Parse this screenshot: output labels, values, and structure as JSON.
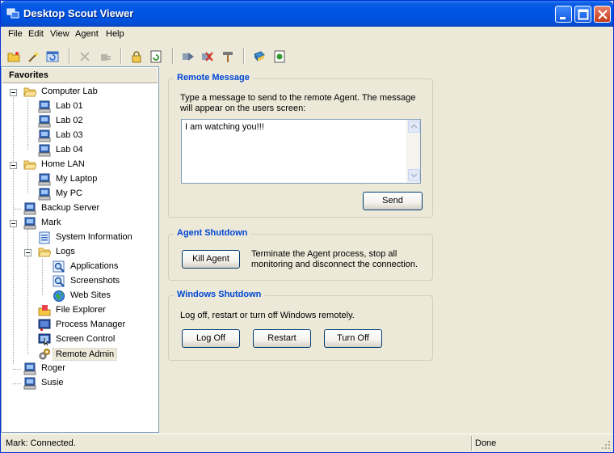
{
  "window": {
    "title": "Desktop Scout Viewer"
  },
  "menu": [
    "File",
    "Edit",
    "View",
    "Agent",
    "Help"
  ],
  "toolbar": {
    "icons": [
      "open-folder-icon",
      "wand-icon",
      "refresh-window-icon",
      "delete-icon",
      "plug-icon",
      "lock-icon",
      "sync-icon",
      "forward-icon",
      "cancel-icon",
      "tool-icon",
      "book-icon",
      "page-icon"
    ]
  },
  "tree": {
    "header": "Favorites",
    "items": [
      {
        "label": "Computer Lab"
      },
      {
        "label": "Lab 01"
      },
      {
        "label": "Lab 02"
      },
      {
        "label": "Lab 03"
      },
      {
        "label": "Lab 04"
      },
      {
        "label": "Home LAN"
      },
      {
        "label": "My Laptop"
      },
      {
        "label": "My PC"
      },
      {
        "label": "Backup Server"
      },
      {
        "label": "Mark"
      },
      {
        "label": "System Information"
      },
      {
        "label": "Logs"
      },
      {
        "label": "Applications"
      },
      {
        "label": "Screenshots"
      },
      {
        "label": "Web Sites"
      },
      {
        "label": "File Explorer"
      },
      {
        "label": "Process Manager"
      },
      {
        "label": "Screen Control"
      },
      {
        "label": "Remote Admin"
      },
      {
        "label": "Roger"
      },
      {
        "label": "Susie"
      }
    ]
  },
  "remote_message": {
    "title": "Remote Message",
    "description_line1": "Type a message to send to the remote Agent. The message",
    "description_line2": "will appear on the users screen:",
    "message": "I am watching you!!!",
    "send_label": "Send"
  },
  "agent_shutdown": {
    "title": "Agent Shutdown",
    "kill_label": "Kill Agent",
    "description_line1": "Terminate the Agent process, stop all",
    "description_line2": "monitoring and disconnect the connection."
  },
  "windows_shutdown": {
    "title": "Windows Shutdown",
    "description": "Log off, restart or turn off Windows remotely.",
    "logoff_label": "Log Off",
    "restart_label": "Restart",
    "turnoff_label": "Turn Off"
  },
  "status": {
    "left": "Mark: Connected.",
    "right": "Done"
  },
  "colors": {
    "titlebar": "#0054e3",
    "group_title": "#0046d5",
    "window_bg": "#ece9d8"
  }
}
